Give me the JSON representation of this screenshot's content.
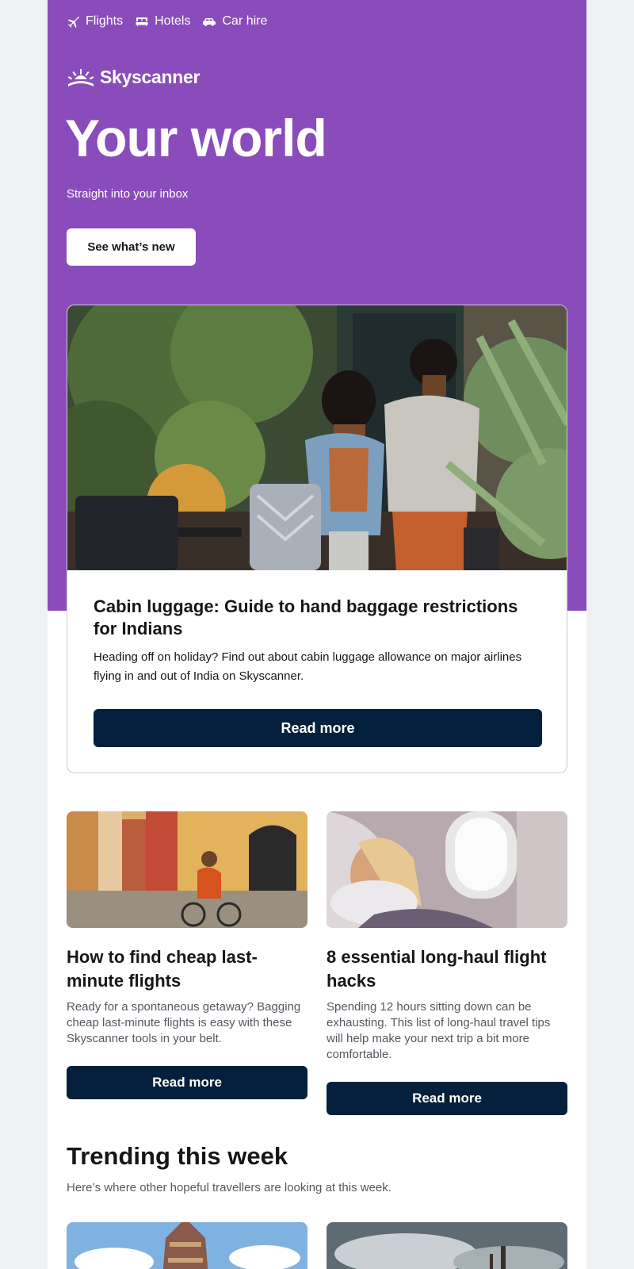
{
  "nav": {
    "items": [
      {
        "label": "Flights",
        "icon": "plane-icon"
      },
      {
        "label": "Hotels",
        "icon": "bed-icon"
      },
      {
        "label": "Car hire",
        "icon": "car-icon"
      }
    ]
  },
  "brand": {
    "name": "Skyscanner",
    "color": "#8a4cbb",
    "dark": "#05203c"
  },
  "hero": {
    "title": "Your world",
    "subtitle": "Straight into your inbox",
    "button_label": "See what’s new"
  },
  "feature": {
    "title": "Cabin luggage: Guide to hand baggage restrictions for Indians",
    "description": "Heading off on holiday? Find out about cabin luggage allowance on major airlines flying in and out of India on Skyscanner.",
    "button_label": "Read more"
  },
  "articles": [
    {
      "title": "How to find cheap last-minute flights",
      "description": "Ready for a spontaneous getaway? Bagging cheap last-minute flights is easy with these Skyscanner tools in your belt.",
      "button_label": "Read more"
    },
    {
      "title": "8 essential long-haul flight hacks",
      "description": "Spending 12 hours sitting down can be exhausting. This list of long-haul travel tips will help make your next trip a bit more comfortable.",
      "button_label": "Read more"
    }
  ],
  "trending": {
    "title": "Trending this week",
    "subtitle": "Here’s where other hopeful travellers are looking at this week."
  }
}
